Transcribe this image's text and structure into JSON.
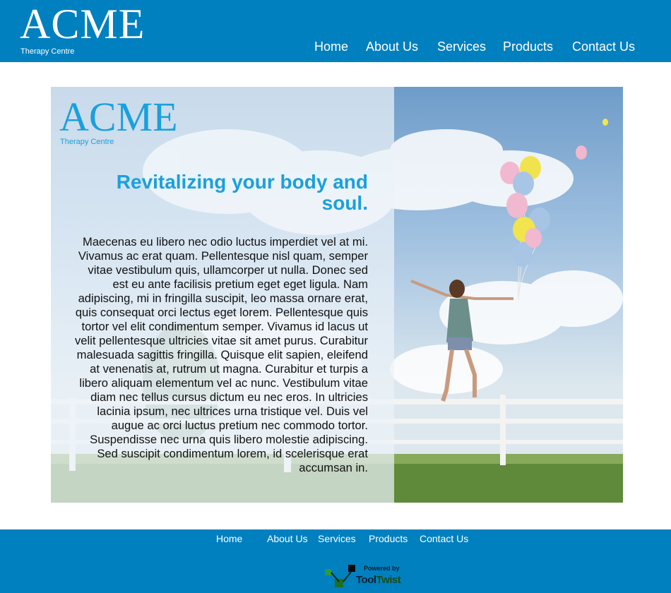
{
  "header": {
    "logo": {
      "word": "ACME",
      "subtitle": "Therapy Centre"
    },
    "nav": [
      {
        "label": "Home"
      },
      {
        "label": "About Us"
      },
      {
        "label": "Services"
      },
      {
        "label": "Products"
      },
      {
        "label": "Contact Us"
      }
    ]
  },
  "hero": {
    "logo": {
      "word": "ACME",
      "subtitle": "Therapy Centre"
    },
    "headline": "Revitalizing your body and soul.",
    "body": "Maecenas eu libero nec odio luctus imperdiet vel at mi. Vivamus ac erat quam. Pellentesque nisl quam, semper vitae vestibulum quis, ullamcorper ut nulla. Donec sed est eu ante facilisis pretium eget eget ligula. Nam adipiscing, mi in fringilla suscipit, leo massa ornare erat, quis consequat orci lectus eget lorem. Pellentesque quis tortor vel elit condimentum semper. Vivamus id lacus ut velit pellentesque ultricies vitae sit amet purus. Curabitur malesuada sagittis fringilla. Quisque elit sapien, eleifend at venenatis at, rutrum ut magna. Curabitur et turpis a libero aliquam elementum vel ac nunc. Vestibulum vitae diam nec tellus cursus dictum eu nec eros. In ultricies lacinia ipsum, nec ultrices urna tristique vel. Duis vel augue ac orci luctus pretium nec commodo tortor. Suspendisse nec urna quis libero molestie adipiscing. Sed suscipit condimentum lorem, id scelerisque erat accumsan in."
  },
  "footer": {
    "nav": [
      {
        "label": "Home"
      },
      {
        "label": "About Us"
      },
      {
        "label": "Services"
      },
      {
        "label": "Products"
      },
      {
        "label": "Contact Us"
      }
    ],
    "powered": {
      "small": "Powered by",
      "brand_a": "Tool",
      "brand_b": "Twist"
    }
  },
  "colors": {
    "brand_blue": "#0080bf",
    "accent_blue": "#1aa0dc",
    "white": "#ffffff"
  }
}
